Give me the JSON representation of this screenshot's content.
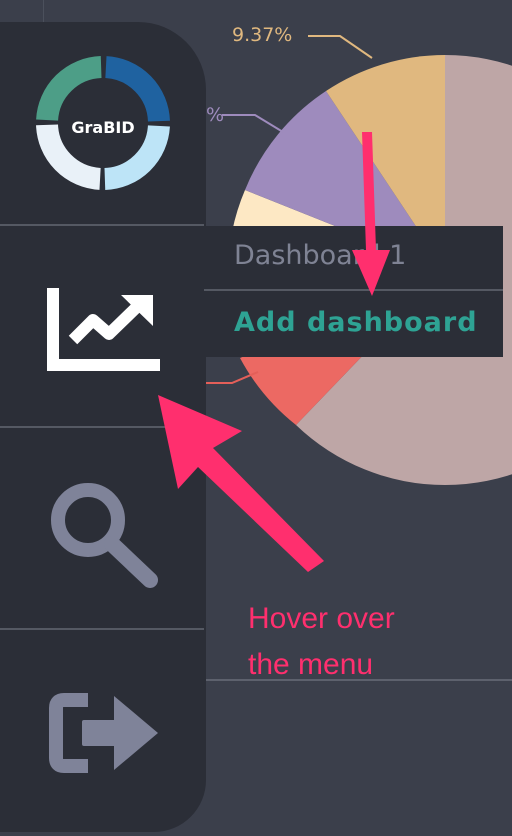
{
  "chart": {
    "labels": {
      "orange_pct": "9.37%",
      "purple_pct_partial": "%"
    },
    "colors": {
      "mauve": "#bea6a6",
      "orange": "#e0b87f",
      "purple": "#9e8bbd",
      "cream": "#fde8c4",
      "red": "#ec6963",
      "leader_red": "#e45f59"
    }
  },
  "sidebar": {
    "logo": {
      "text": "GraBID",
      "ring_colors": [
        "#1f62a0",
        "#bde4f7",
        "#e9f1f8",
        "#4d9e87"
      ]
    },
    "items": [
      {
        "name": "dashboards",
        "icon": "trending-up-chart-icon"
      },
      {
        "name": "search",
        "icon": "search-icon"
      },
      {
        "name": "logout",
        "icon": "logout-icon"
      }
    ],
    "colors": {
      "background": "#2b2e37",
      "icon_active": "#ffffff",
      "icon_muted": "#7f8399"
    }
  },
  "dropdown": {
    "items": [
      {
        "label": "Dashboard 1"
      },
      {
        "label": "Add dashboard"
      }
    ],
    "colors": {
      "item": "#7f8394",
      "add": "#2ea394"
    }
  },
  "annotation": {
    "line1": "Hover over",
    "line2": "the menu",
    "color": "#ff2f6e"
  }
}
